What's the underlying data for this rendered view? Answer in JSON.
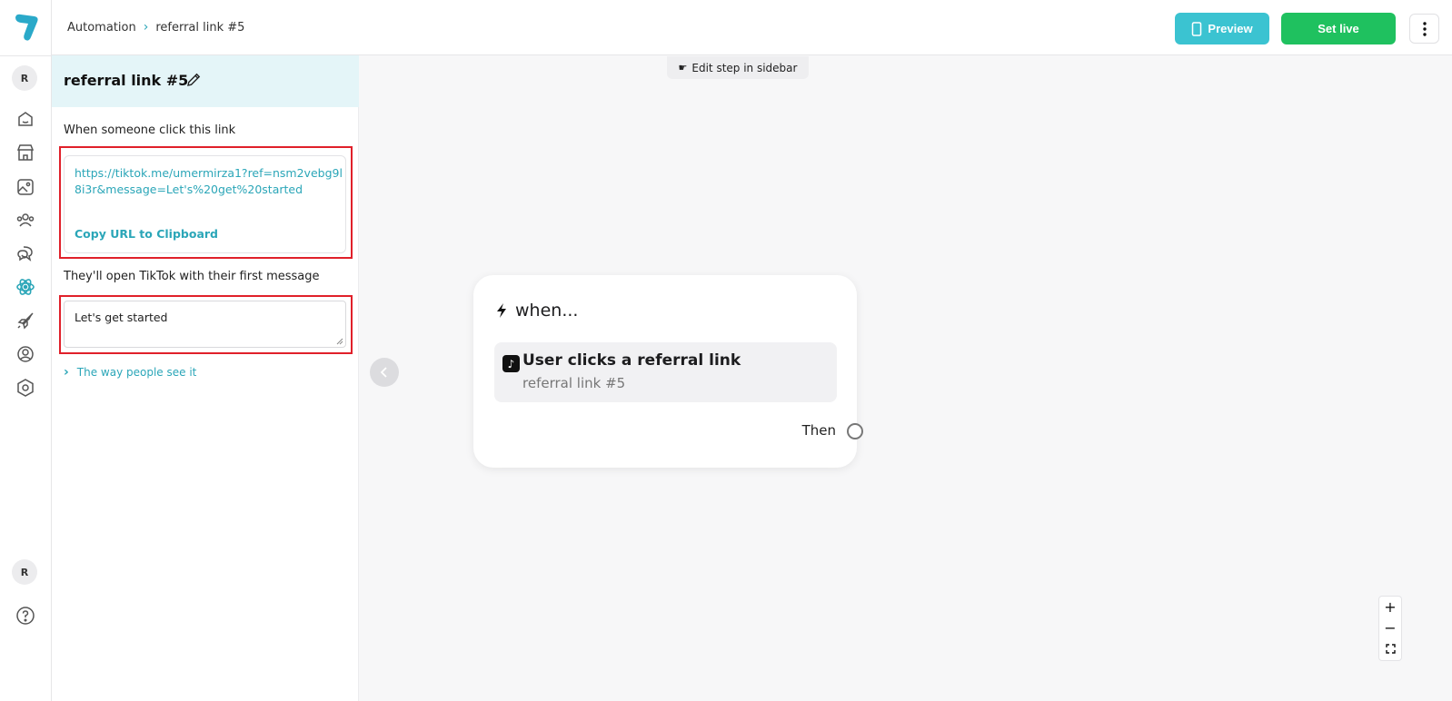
{
  "breadcrumb": {
    "root": "Automation",
    "current": "referral link #5"
  },
  "header": {
    "preview_label": "Preview",
    "set_live_label": "Set live"
  },
  "rail": {
    "avatar_top": "R",
    "avatar_bottom": "R",
    "icons": [
      "home-icon",
      "store-icon",
      "media-icon",
      "contacts-icon",
      "chat-icon",
      "automation-icon",
      "growth-icon",
      "account-icon",
      "settings-icon",
      "help-icon"
    ],
    "active_icon": "automation-icon"
  },
  "panel": {
    "title": "referral link #5",
    "click_label": "When someone click this link",
    "url": "https://tiktok.me/umermirza1?ref=nsm2vebg9l8i3r&message=Let's%20get%20started",
    "copy_label": "Copy URL to Clipboard",
    "message_label": "They'll open TikTok with their first message",
    "message_value": "Let's get started",
    "preview_toggle": "The way people see it"
  },
  "canvas": {
    "hint": "Edit step in sidebar",
    "node": {
      "title": "when...",
      "trigger_title": "User clicks a referral link",
      "trigger_subtitle": "referral link #5",
      "then_label": "Then"
    }
  },
  "colors": {
    "accent": "#2ba6b8",
    "preview_button": "#3bc3d1",
    "set_live_button": "#1fc15f",
    "highlight_box": "#e0202a"
  }
}
